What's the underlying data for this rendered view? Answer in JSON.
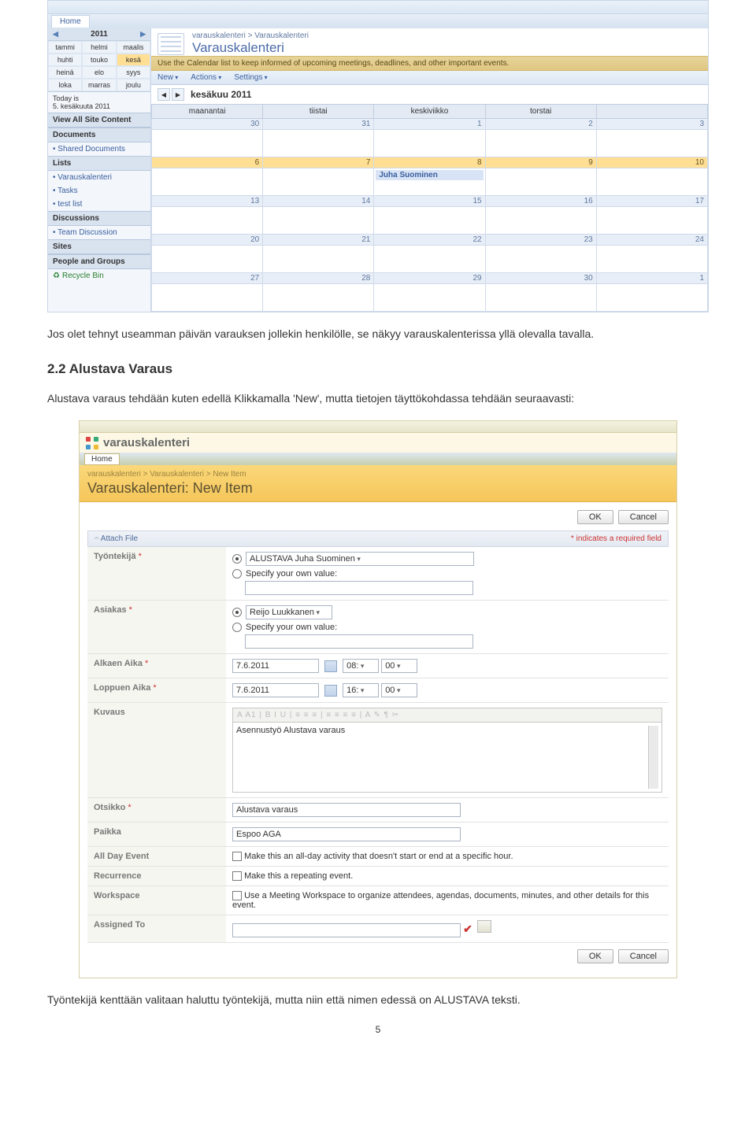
{
  "document": {
    "para1": "Jos olet tehnyt useamman päivän varauksen jollekin henkilölle, se näkyy varauskalenterissa yllä olevalla tavalla.",
    "section_title": "2.2 Alustava Varaus",
    "para2": "Alustava varaus tehdään kuten edellä Klikkamalla 'New', mutta tietojen täyttökohdassa tehdään seuraavasti:",
    "para3": "Työntekijä kenttään valitaan haluttu työntekijä, mutta niin että nimen edessä on ALUSTAVA teksti.",
    "page_number": "5"
  },
  "calendar_shot": {
    "home_tab": "Home",
    "breadcrumb": "varauskalenteri > Varauskalenteri",
    "title": "Varauskalenteri",
    "desc": "Use the Calendar list to keep informed of upcoming meetings, deadlines, and other important events.",
    "toolbar": {
      "new": "New",
      "actions": "Actions",
      "settings": "Settings"
    },
    "month_title": "kesäkuu 2011",
    "weekdays": [
      "maanantai",
      "tiistai",
      "keskiviikko",
      "torstai",
      ""
    ],
    "sidebar": {
      "year": "2011",
      "months": [
        "tammi",
        "helmi",
        "maalis",
        "huhti",
        "touko",
        "kesä",
        "heinä",
        "elo",
        "syys",
        "loka",
        "marras",
        "joulu"
      ],
      "current_index": 5,
      "today_label": "Today is",
      "today_value": "5. kesäkuuta 2011",
      "view_all": "View All Site Content",
      "documents_hdr": "Documents",
      "documents_items": [
        "Shared Documents"
      ],
      "lists_hdr": "Lists",
      "lists_items": [
        "Varauskalenteri",
        "Tasks",
        "test list"
      ],
      "discussions_hdr": "Discussions",
      "discussions_items": [
        "Team Discussion"
      ],
      "sites_hdr": "Sites",
      "people_hdr": "People and Groups",
      "recycle": "Recycle Bin"
    },
    "weeks": [
      {
        "nums": [
          "30",
          "31",
          "1",
          "2",
          "3"
        ],
        "highlights": []
      },
      {
        "nums": [
          "6",
          "7",
          "8",
          "9",
          "10"
        ],
        "highlights": [
          0,
          1,
          2,
          3,
          4
        ],
        "event": {
          "col": 2,
          "text": "Juha Suominen"
        }
      },
      {
        "nums": [
          "13",
          "14",
          "15",
          "16",
          "17"
        ],
        "highlights": []
      },
      {
        "nums": [
          "20",
          "21",
          "22",
          "23",
          "24"
        ],
        "highlights": []
      },
      {
        "nums": [
          "27",
          "28",
          "29",
          "30",
          "1"
        ],
        "highlights": []
      }
    ]
  },
  "form_shot": {
    "brand": "varauskalenteri",
    "home_tab": "Home",
    "breadcrumb": "varauskalenteri > Varauskalenteri > New Item",
    "title": "Varauskalenteri: New Item",
    "btn_ok": "OK",
    "btn_cancel": "Cancel",
    "attach": "Attach File",
    "required_note": "indicates a required field",
    "rows": {
      "tyontekija": {
        "label": "Työntekijä",
        "req": true,
        "opt_value": "ALUSTAVA Juha Suominen",
        "specify": "Specify your own value:"
      },
      "asiakas": {
        "label": "Asiakas",
        "req": true,
        "opt_value": "Reijo Luukkanen",
        "specify": "Specify your own value:"
      },
      "alkaen": {
        "label": "Alkaen Aika",
        "req": true,
        "date": "7.6.2011",
        "h": "08:",
        "m": "00"
      },
      "loppuen": {
        "label": "Loppuen Aika",
        "req": true,
        "date": "7.6.2011",
        "h": "16:",
        "m": "00"
      },
      "kuvaus": {
        "label": "Kuvaus",
        "toolbar": "A  A1 |  B  I  U  |  ≡  ≡  ≡  |  ≡  ≡  ≡  ≡  |  A  ✎  ¶  ✂",
        "value": "Asennustyö Alustava varaus"
      },
      "otsikko": {
        "label": "Otsikko",
        "req": true,
        "value": "Alustava varaus"
      },
      "paikka": {
        "label": "Paikka",
        "value": "Espoo AGA"
      },
      "allday": {
        "label": "All Day Event",
        "desc": "Make this an all-day activity that doesn't start or end at a specific hour."
      },
      "recurrence": {
        "label": "Recurrence",
        "desc": "Make this a repeating event."
      },
      "workspace": {
        "label": "Workspace",
        "desc": "Use a Meeting Workspace to organize attendees, agendas, documents, minutes, and other details for this event."
      },
      "assigned": {
        "label": "Assigned To"
      }
    }
  }
}
